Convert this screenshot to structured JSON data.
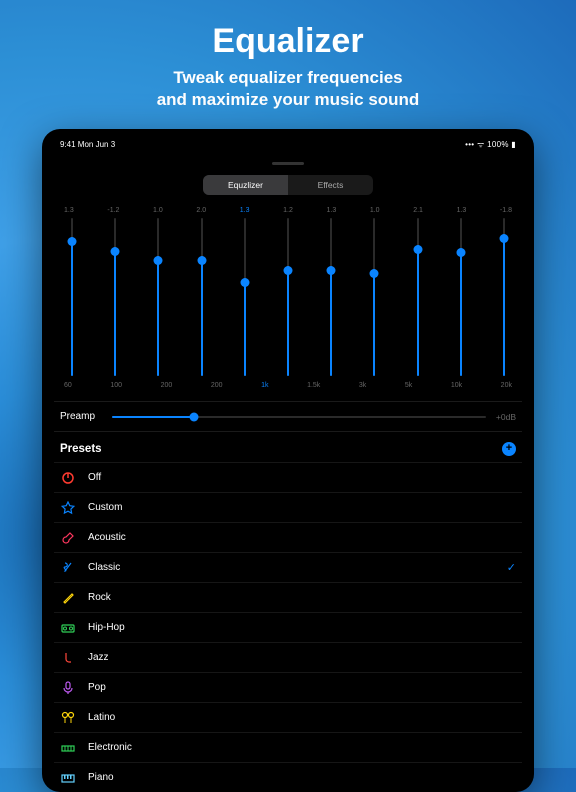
{
  "promo": {
    "title": "Equalizer",
    "subtitle_l1": "Tweak equalizer frequencies",
    "subtitle_l2": "and maximize your music sound"
  },
  "statusbar": {
    "time": "9:41  Mon Jun 3",
    "battery": "100%"
  },
  "tabs": {
    "equalizer": "Equzlizer",
    "effects": "Effects",
    "active": 0
  },
  "eq": {
    "values": [
      "1.3",
      "-1.2",
      "1.0",
      "2.0",
      "1.3",
      "1.2",
      "1.3",
      "1.0",
      "2.1",
      "1.3",
      "-1.8"
    ],
    "labels": [
      "60",
      "100",
      "200",
      "200",
      "1k",
      "1.5k",
      "3k",
      "5k",
      "10k",
      "20k"
    ],
    "highlightIdx": 4,
    "positions": [
      12,
      18,
      24,
      24,
      38,
      30,
      30,
      32,
      17,
      19,
      10
    ]
  },
  "preamp": {
    "label": "Preamp",
    "value": "+0dB"
  },
  "presets": {
    "header": "Presets",
    "items": [
      {
        "name": "Off",
        "color": "#ff3b30",
        "glyph": "power"
      },
      {
        "name": "Custom",
        "color": "#0a84ff",
        "glyph": "star"
      },
      {
        "name": "Acoustic",
        "color": "#ff375f",
        "glyph": "guitar"
      },
      {
        "name": "Classic",
        "color": "#0a84ff",
        "glyph": "violin",
        "selected": true
      },
      {
        "name": "Rock",
        "color": "#ffd60a",
        "glyph": "eguitar"
      },
      {
        "name": "Hip-Hop",
        "color": "#30d158",
        "glyph": "boombox"
      },
      {
        "name": "Jazz",
        "color": "#ff453a",
        "glyph": "sax"
      },
      {
        "name": "Pop",
        "color": "#bf5af2",
        "glyph": "mic"
      },
      {
        "name": "Latino",
        "color": "#ffd60a",
        "glyph": "maracas"
      },
      {
        "name": "Electronic",
        "color": "#30d158",
        "glyph": "synth"
      },
      {
        "name": "Piano",
        "color": "#64d2ff",
        "glyph": "piano"
      }
    ]
  }
}
